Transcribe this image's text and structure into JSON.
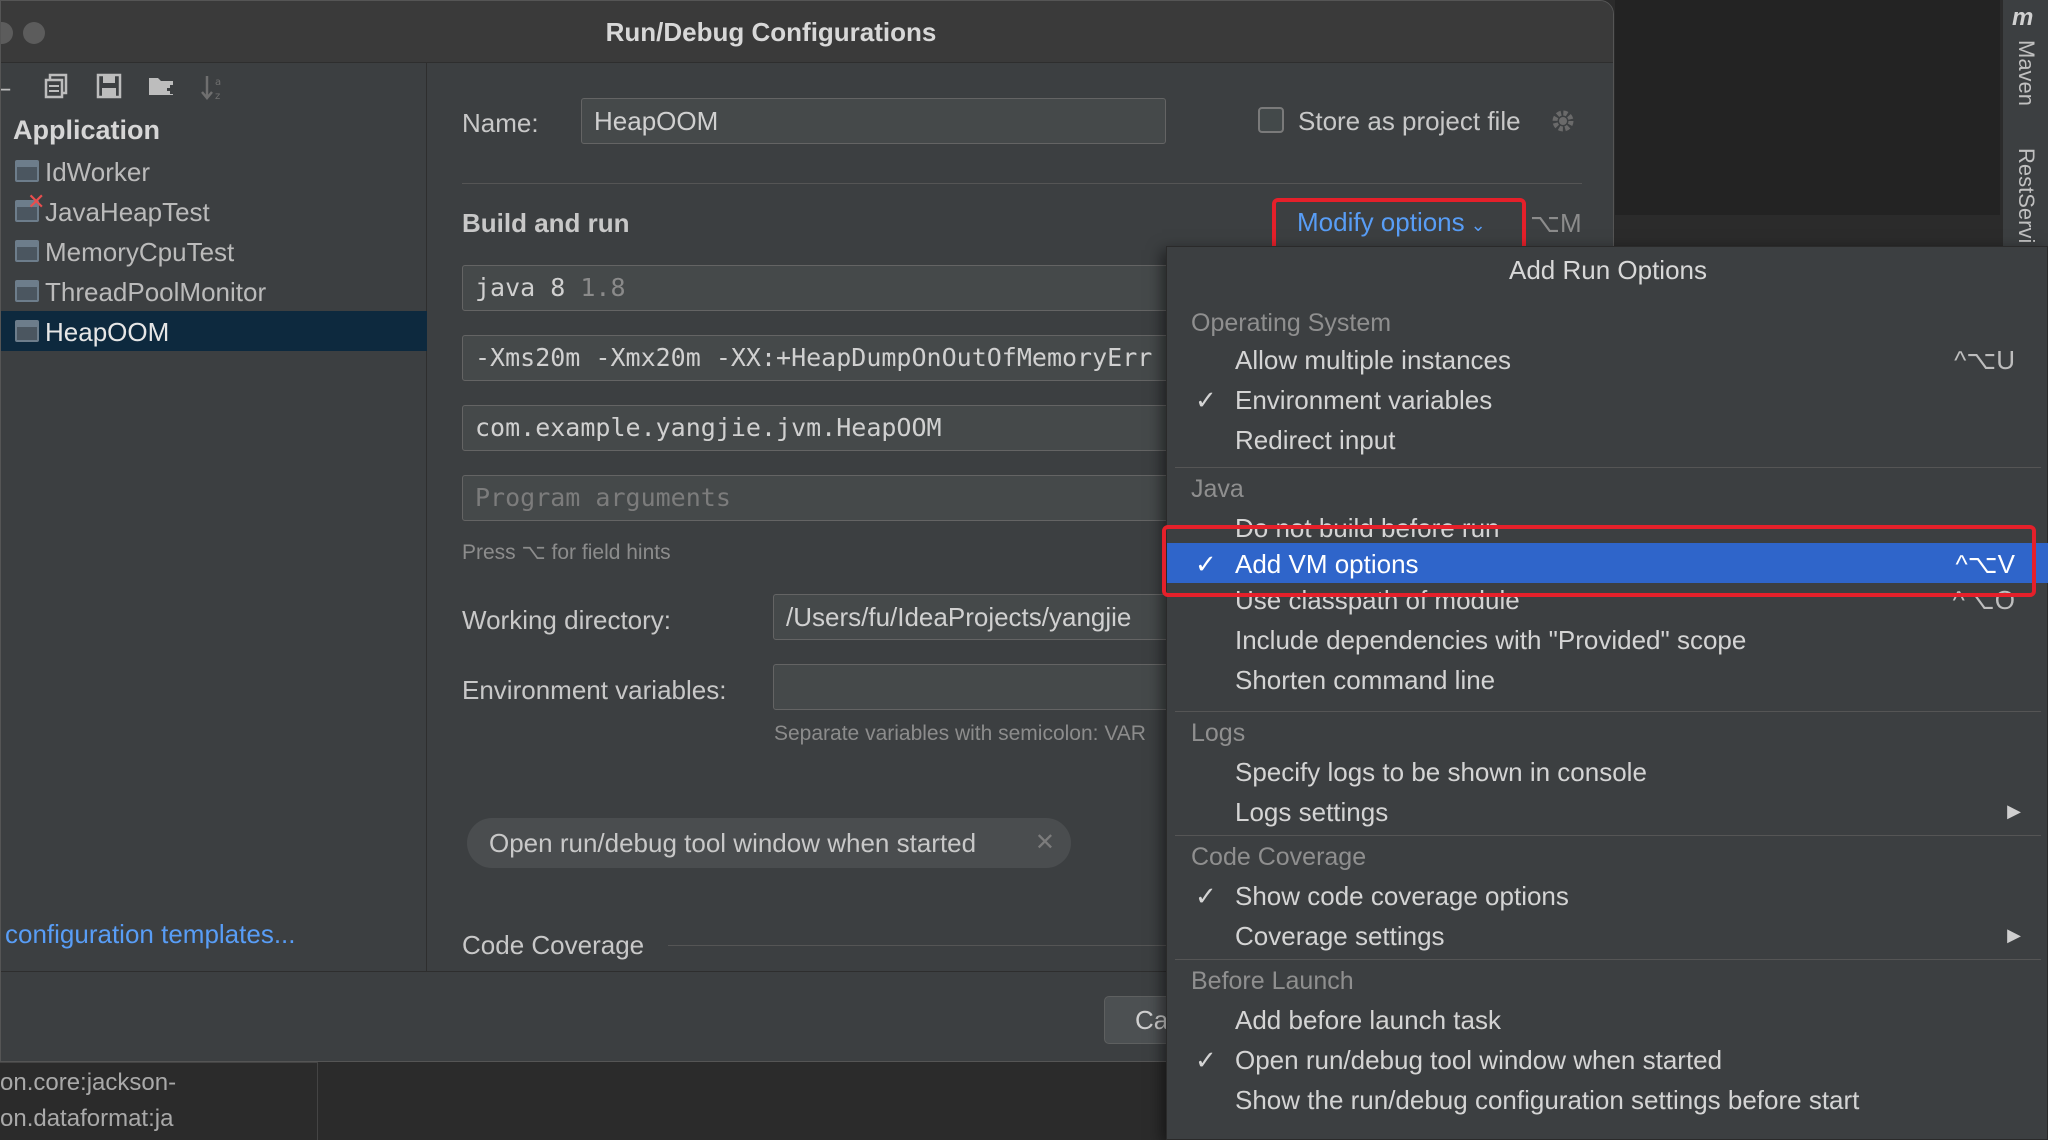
{
  "dialog": {
    "title": "Run/Debug Configurations"
  },
  "toolbar": {
    "icons": [
      "remove-icon",
      "copy-icon",
      "save-icon",
      "folder-add-icon",
      "sort-icon"
    ]
  },
  "tree": {
    "root": "Application",
    "items": [
      {
        "label": "IdWorker"
      },
      {
        "label": "JavaHeapTest",
        "error": true
      },
      {
        "label": "MemoryCpuTest"
      },
      {
        "label": "ThreadPoolMonitor"
      },
      {
        "label": "HeapOOM",
        "selected": true
      }
    ],
    "templates_link": "configuration templates..."
  },
  "form": {
    "name_label": "Name:",
    "name_value": "HeapOOM",
    "store_label": "Store as project file",
    "build_run_label": "Build and run",
    "modify_options": "Modify options",
    "modify_shortcut": "⌥M",
    "jdk_value": "java 8",
    "jdk_version": "1.8",
    "vm_options_value": "-Xms20m -Xmx20m -XX:+HeapDumpOnOutOfMemoryErr",
    "main_class_value": "com.example.yangjie.jvm.HeapOOM",
    "program_args_placeholder": "Program arguments",
    "field_hint": "Press ⌥ for field hints",
    "working_dir_label": "Working directory:",
    "working_dir_value": "/Users/fu/IdeaProjects/yangjie",
    "env_vars_label": "Environment variables:",
    "env_vars_hint": "Separate variables with semicolon: VAR",
    "chip_label": "Open run/debug tool window when started",
    "code_coverage_label": "Code Coverage",
    "cancel_label": "Ca"
  },
  "popup": {
    "title": "Add Run Options",
    "groups": {
      "os": "Operating System",
      "java": "Java",
      "logs": "Logs",
      "coverage": "Code Coverage",
      "before": "Before Launch"
    },
    "options": {
      "allow_multiple": {
        "label": "Allow multiple instances",
        "shortcut": "^⌥U"
      },
      "env_vars": {
        "label": "Environment variables",
        "checked": true
      },
      "redirect_input": {
        "label": "Redirect input"
      },
      "no_build": {
        "label": "Do not build before run"
      },
      "add_vm": {
        "label": "Add VM options",
        "shortcut": "^⌥V",
        "checked": true,
        "highlighted": true
      },
      "use_classpath": {
        "label": "Use classpath of module",
        "shortcut": "^⌥O"
      },
      "include_deps": {
        "label": "Include dependencies with \"Provided\" scope"
      },
      "shorten_cmd": {
        "label": "Shorten command line"
      },
      "specify_logs": {
        "label": "Specify logs to be shown in console"
      },
      "logs_settings": {
        "label": "Logs settings"
      },
      "show_coverage": {
        "label": "Show code coverage options",
        "checked": true
      },
      "coverage_settings": {
        "label": "Coverage settings"
      },
      "add_before_task": {
        "label": "Add before launch task"
      },
      "open_tool_window": {
        "label": "Open run/debug tool window when started",
        "checked": true
      },
      "show_settings": {
        "label": "Show the run/debug configuration settings before start"
      }
    },
    "check_glyph": "✓"
  },
  "ide": {
    "side_tabs": [
      "Maven",
      "RestServi"
    ],
    "maven_logo": "m",
    "bottom_lines": [
      "on.core:jackson-",
      "on.dataformat:ja"
    ]
  },
  "colors": {
    "accent_link": "#589df6",
    "selection": "#2f65ca",
    "highlight_box": "#e5202a"
  }
}
